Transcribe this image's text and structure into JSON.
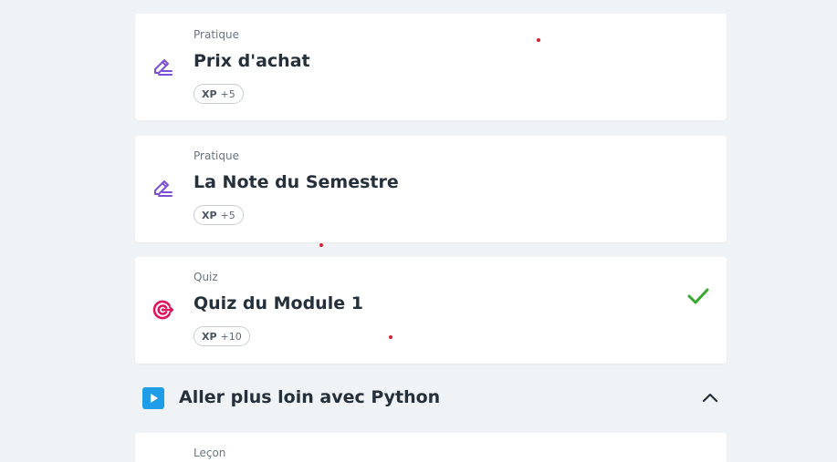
{
  "lessons": [
    {
      "type": "Pratique",
      "title": "Prix d'achat",
      "xp_label": "XP",
      "xp_value": "+5",
      "icon": "pencil-lines-icon",
      "completed": false
    },
    {
      "type": "Pratique",
      "title": "La Note du Semestre",
      "xp_label": "XP",
      "xp_value": "+5",
      "icon": "pencil-lines-icon",
      "completed": false
    },
    {
      "type": "Quiz",
      "title": "Quiz du Module 1",
      "xp_label": "XP",
      "xp_value": "+10",
      "icon": "target-icon",
      "completed": true
    }
  ],
  "section": {
    "title": "Aller plus loin avec Python",
    "icon": "play-icon",
    "expanded": true
  },
  "next_lesson": {
    "type": "Leçon"
  },
  "colors": {
    "background": "#f0f3f6",
    "practice_icon": "#7b4fd6",
    "quiz_icon": "#e0145c",
    "check": "#3aa82e",
    "play": "#1f9de8",
    "title_text": "#25303b",
    "muted_text": "#6a7582"
  }
}
